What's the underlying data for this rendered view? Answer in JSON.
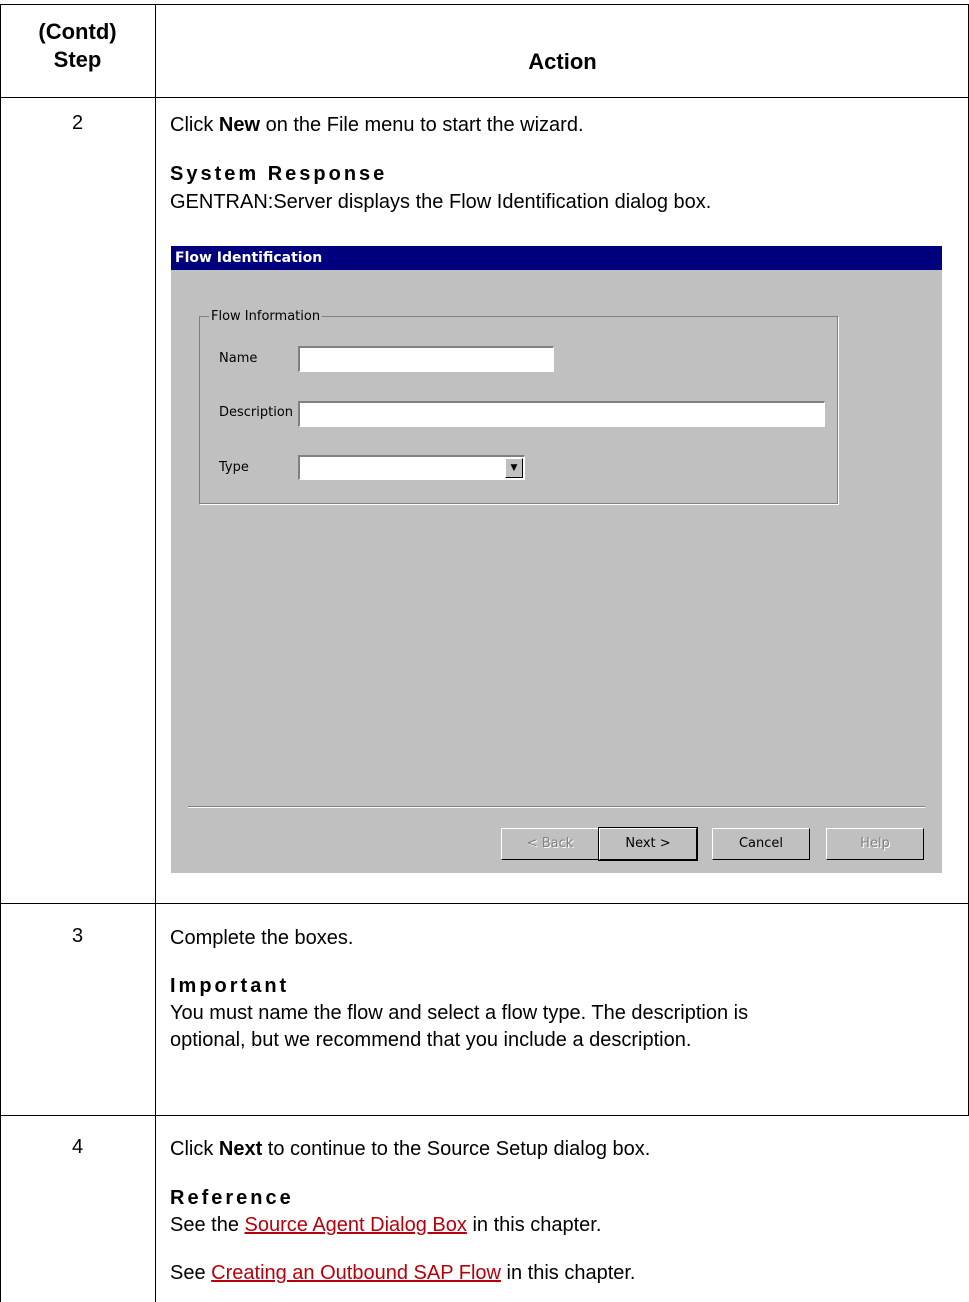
{
  "header": {
    "step_label_1": "(Contd)",
    "step_label_2": "Step",
    "action_label": "Action"
  },
  "rows": [
    {
      "step": "2",
      "line1_pre": "Click ",
      "line1_bold": "New",
      "line1_post": " on the File menu to start the wizard.",
      "subheading": "System Response",
      "body": "GENTRAN:Server displays the Flow Identification dialog box."
    },
    {
      "step": "3",
      "line1": "Complete the boxes.",
      "subheading": "Important",
      "body": "You must name the flow and select a flow type. The description is optional, but we recommend that you include a description."
    },
    {
      "step": "4",
      "line1_pre": "Click ",
      "line1_bold": "Next",
      "line1_post": " to continue to the Source Setup dialog box.",
      "subheading": "Reference",
      "ref1_pre": "See the ",
      "ref1_link": "Source Agent Dialog Box",
      "ref1_post": " in this chapter.",
      "ref2_pre": "See ",
      "ref2_link": "Creating an Outbound SAP Flow",
      "ref2_post": " in this chapter."
    }
  ],
  "dialog": {
    "title": "Flow Identification",
    "group_label": "Flow Information",
    "name_label": "Name",
    "name_value": "",
    "description_label": "Description",
    "description_value": "",
    "type_label": "Type",
    "type_value": "",
    "buttons": {
      "back": "< Back",
      "next": "Next >",
      "cancel": "Cancel",
      "help": "Help"
    }
  },
  "colors": {
    "title_bar": "#00007f",
    "dialog_bg": "#c0c0c0",
    "link": "#b8000a"
  }
}
